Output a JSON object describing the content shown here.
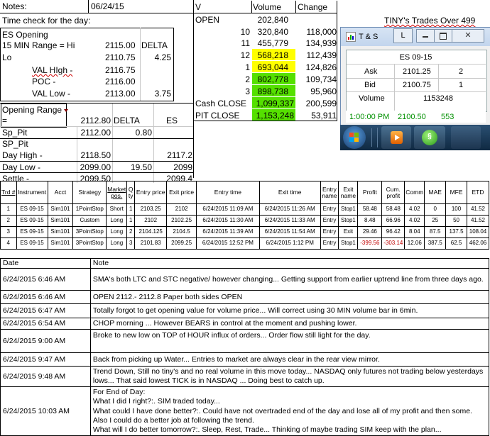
{
  "header": {
    "notes_label": "Notes:",
    "date_value": "06/24/15",
    "time_check_label": "Time check for the day:",
    "tiny_label": "TINY's Trades Over 499"
  },
  "es_opening": {
    "title": "ES Opening",
    "rows": [
      {
        "label": "15 MIN Range = Hi",
        "value": "2115.00",
        "extra": "DELTA"
      },
      {
        "label": "Lo",
        "value": "2110.75",
        "extra": "4.25"
      },
      {
        "label": "VAL HIgh   -",
        "value": "2116.75",
        "extra": ""
      },
      {
        "label": "POC   -",
        "value": "2116.00",
        "extra": ""
      },
      {
        "label": "VAL Low   -",
        "value": "2113.00",
        "extra": "3.75"
      }
    ]
  },
  "opening_range": {
    "title": "Opening Range",
    "eq_label": "=",
    "eq_value": "2112.80",
    "delta_label": "DELTA",
    "es_label": "ES",
    "sp_pit_label": "Sp_Pit",
    "sp_pit_value": "2112.00",
    "sp_pit_delta": "0.80",
    "sp_pit2_label": "SP_Pit",
    "day_high_label": " Day High -",
    "day_high_value": "2118.50",
    "day_high_es": "2117.2",
    "day_low_label": "Day Low -",
    "day_low_value": "2099.00",
    "day_low_delta": "19.50",
    "day_low_es": "2099",
    "settle_label": "Settle -",
    "settle_value": "2099.50",
    "settle_es": "2099.4"
  },
  "volume_table": {
    "headers": [
      "V",
      "Volume",
      "Change"
    ],
    "open_label": "OPEN",
    "open_volume": "202,840",
    "rows": [
      {
        "v": "10",
        "volume": "320,840",
        "change": "118,000",
        "hl": ""
      },
      {
        "v": "11",
        "volume": "455,779",
        "change": "134,939",
        "hl": ""
      },
      {
        "v": "12",
        "volume": "568,218",
        "change": "112,439",
        "hl": "yellow"
      },
      {
        "v": "1",
        "volume": "693,044",
        "change": "124,826",
        "hl": "yellow"
      },
      {
        "v": "2",
        "volume": "802,778",
        "change": "109,734",
        "hl": "green"
      },
      {
        "v": "3",
        "volume": "898,738",
        "change": "95,960",
        "hl": "green"
      }
    ],
    "cash_close_label": "Cash CLOSE",
    "cash_close_volume": "1,099,337",
    "cash_close_change": "200,599",
    "pit_close_label": "PIT CLOSE",
    "pit_close_volume": "1,153,248",
    "pit_close_change": "53,911"
  },
  "ts_window": {
    "title": "T & S",
    "btn_l": "L",
    "instrument": "ES 09-15",
    "ask_label": "Ask",
    "ask_price": "2101.25",
    "ask_size": "2",
    "bid_label": "Bid",
    "bid_price": "2100.75",
    "bid_size": "1",
    "volume_label": "Volume",
    "volume_value": "1153248",
    "tick_time": "1:00:00 PM",
    "tick_price": "2100.50",
    "tick_size": "553"
  },
  "trades": {
    "headers": [
      "Trd #",
      "Instrument",
      "Acct",
      "Strategy",
      "Market pos.",
      "Qty",
      "Entry price",
      "Exit price",
      "Entry time",
      "Exit time",
      "Entry name",
      "Exit name",
      "Profit",
      "Cum. profit",
      "Comm",
      "MAE",
      "MFE",
      "ETD"
    ],
    "rows": [
      [
        "1",
        "ES 09-15",
        "Sim101",
        "1PointStop",
        "Short",
        "1",
        "2103.25",
        "2102",
        "6/24/2015 11:09 AM",
        "6/24/2015 11:26 AM",
        "Entry",
        "Stop1",
        "58.48",
        "58.48",
        "4.02",
        "0",
        "100",
        "41.52"
      ],
      [
        "2",
        "ES 09-15",
        "Sim101",
        "Custom",
        "Long",
        "1",
        "2102",
        "2102.25",
        "6/24/2015 11:30 AM",
        "6/24/2015 11:33 AM",
        "Entry",
        "Stop1",
        "8.48",
        "66.96",
        "4.02",
        "25",
        "50",
        "41.52"
      ],
      [
        "3",
        "ES 09-15",
        "Sim101",
        "3PointStop",
        "Long",
        "2",
        "2104.125",
        "2104.5",
        "6/24/2015 11:39 AM",
        "6/24/2015 11:54 AM",
        "Entry",
        "Exit",
        "29.46",
        "96.42",
        "8.04",
        "87.5",
        "137.5",
        "108.04"
      ],
      [
        "4",
        "ES 09-15",
        "Sim101",
        "3PointStop",
        "Long",
        "3",
        "2101.83",
        "2099.25",
        "6/24/2015 12:52 PM",
        "6/24/2015 1:12 PM",
        "Entry",
        "Stop1",
        "-399.56",
        "-303.14",
        "12.06",
        "387.5",
        "62.5",
        "462.06"
      ]
    ]
  },
  "notes_table": {
    "headers": [
      "Date",
      "Note"
    ],
    "rows": [
      {
        "date": "6/24/2015 6:46 AM",
        "note": "SMA's both LTC and STC negative/ however changing... Getting support from earlier uptrend line from three days ago."
      },
      {
        "date": "6/24/2015 6:46 AM",
        "note": "OPEN 2112.- 2112.8 Paper both sides OPEN"
      },
      {
        "date": "6/24/2015 6:47 AM",
        "note": "Totally forgot to get opening value for volume price... Will correct using 30 MIN volume bar in 6min."
      },
      {
        "date": "6/24/2015 6:54 AM",
        "note": "CHOP morning ... However BEARS in control at the moment and pushing lower."
      },
      {
        "date": "6/24/2015 9:00 AM",
        "note": "Broke to new low on TOP of HOUR influx of orders...  Order flow still light for the day."
      },
      {
        "date": "6/24/2015 9:47 AM",
        "note": "Back from picking up Water... Entries to market are always clear in the rear view mirror."
      },
      {
        "date": "6/24/2015 9:48 AM",
        "note": "Trend Down, Still no tiny's and no real volume in this move today... NASDAQ only futures not trading below yesterdays lows... That said lowest TICK is in NASDAQ ... Doing best to catch up."
      },
      {
        "date": "6/24/2015 10:03 AM",
        "note_lines": [
          "For End of Day:",
          "What I did I right?:.  SIM traded today...",
          "What could I have done better?:.  Could have not overtraded end of the day and lose all of my profit and then some.",
          "Also I could do a better job at following the trend.",
          "What will I do better tomorrow?:.  Sleep, Rest, Trade... Thinking of maybe trading SIM keep with the plan..."
        ]
      }
    ]
  },
  "colors": {
    "highlight_yellow": "#ffff00",
    "highlight_green": "#55e000",
    "negative_red": "#c00000",
    "tick_green": "#009000"
  },
  "icons": [
    "windows-start-icon",
    "media-player-icon",
    "ninjatrader-icon",
    "ts-window-icon"
  ]
}
